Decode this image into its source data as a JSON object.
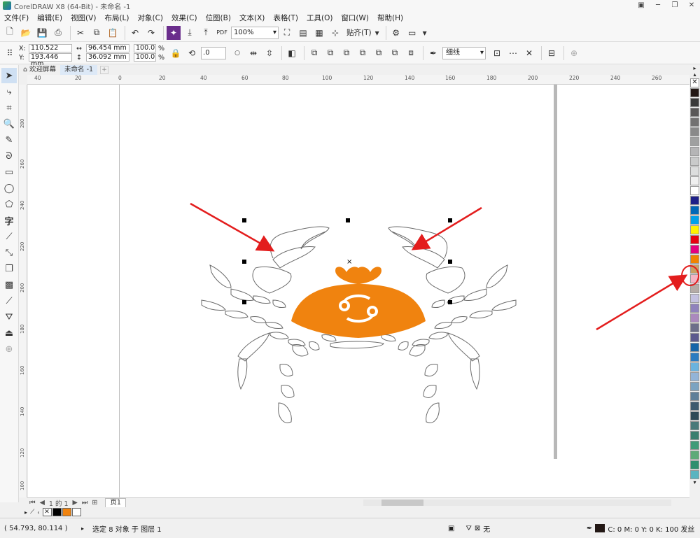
{
  "window": {
    "title": "CorelDRAW X8 (64-Bit) - 未命名 -1"
  },
  "menu": [
    "文件(F)",
    "编辑(E)",
    "视图(V)",
    "布局(L)",
    "对象(C)",
    "效果(C)",
    "位图(B)",
    "文本(X)",
    "表格(T)",
    "工具(O)",
    "窗口(W)",
    "帮助(H)"
  ],
  "toolbar": {
    "zoom": "100%",
    "snap_label": "贴齐(T)",
    "pdf_label": "PDF"
  },
  "property_bar": {
    "x": "110.522 mm",
    "y": "193.446 mm",
    "width": "96.454 mm",
    "height": "36.092 mm",
    "scale_x": "100.0",
    "scale_y": "100.0",
    "pct": "%",
    "x_label": "X:",
    "y_label": "Y:",
    "rotation": ".0",
    "outline": "细线"
  },
  "tabs": [
    {
      "label": "欢迎屏幕"
    },
    {
      "label": "未命名 -1"
    }
  ],
  "ruler_h": [
    "40",
    "20",
    "0",
    "20",
    "40",
    "60",
    "80",
    "100",
    "120",
    "140",
    "160",
    "180",
    "200",
    "220",
    "240",
    "260"
  ],
  "ruler_v": [
    "280",
    "260",
    "240",
    "220",
    "200",
    "180",
    "160",
    "140",
    "120",
    "100"
  ],
  "page_nav": {
    "page_counter": "1 的 1",
    "page_tab": "页1"
  },
  "status": {
    "cursor": "( 54.793, 80.114 )",
    "selection": "选定 8 对象 于 图层 1",
    "fill_none": "无",
    "outline_info": "C: 0 M: 0 Y: 0 K: 100  发丝"
  },
  "colors": {
    "accent": "#f0830f",
    "arrow": "#e31d1d",
    "palette": [
      "#231815",
      "#3a3a3a",
      "#595757",
      "#727171",
      "#898989",
      "#9fa0a0",
      "#b5b5b6",
      "#c9caca",
      "#dcdddd",
      "#efefef",
      "#ffffff",
      "#1d2088",
      "#0068b7",
      "#00a0e9",
      "#fff100",
      "#e60012",
      "#e4007f",
      "#f08300",
      "#c9a063",
      "#f4b4c4",
      "#b5aba6",
      "#c4c1e0",
      "#8f82bc",
      "#aa89bd",
      "#6c6f8a",
      "#5c5a8e",
      "#1565a8",
      "#2b7bc0",
      "#6bb3de",
      "#93b4d7",
      "#7ba3c1",
      "#5f7f99",
      "#3d5a6e",
      "#2e4a57",
      "#4a7a7a",
      "#3b7f6f",
      "#3f9b78",
      "#5eaa79",
      "#2f8f6f",
      "#5ab4c0"
    ]
  },
  "doc_palette": [
    "#000000",
    "#f0830f",
    "#ffffff"
  ]
}
